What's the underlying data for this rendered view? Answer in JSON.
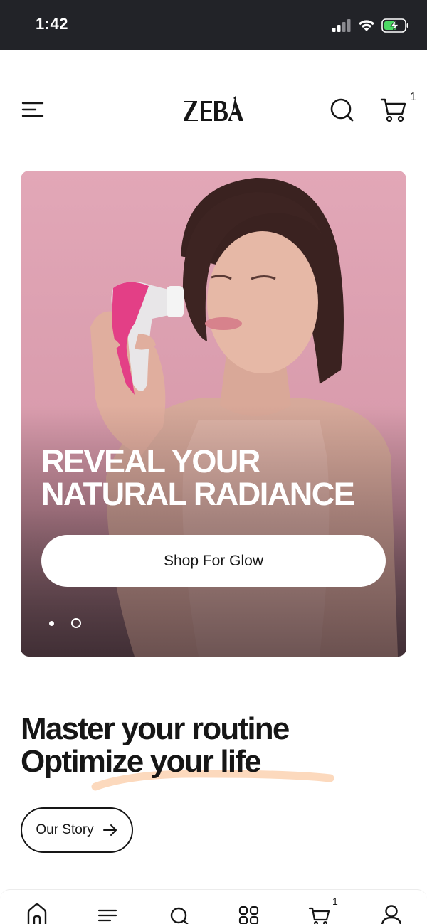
{
  "status_bar": {
    "time": "1:42",
    "icons": [
      "cellular-signal-icon",
      "wifi-icon",
      "battery-charging-icon"
    ],
    "battery_color": "#4cd964"
  },
  "header": {
    "logo_text": "ZEBA",
    "cart_count": "1",
    "icons": [
      "menu-icon",
      "search-icon",
      "cart-icon"
    ]
  },
  "hero": {
    "title_line1": "REVEAL YOUR",
    "title_line2": "NATURAL RADIANCE",
    "cta_label": "Shop For Glow",
    "slides": 2,
    "active_slide": 2,
    "background_color": "#dda3b3"
  },
  "story": {
    "heading_line1": "Master your routine",
    "heading_line2": "Optimize your life",
    "button_label": "Our Story",
    "underline_color": "#fcd9bd"
  },
  "bottom_nav": {
    "items": [
      "home-icon",
      "menu-icon",
      "search-icon",
      "grid-icon",
      "cart-icon",
      "account-icon"
    ],
    "cart_badge": "1"
  }
}
